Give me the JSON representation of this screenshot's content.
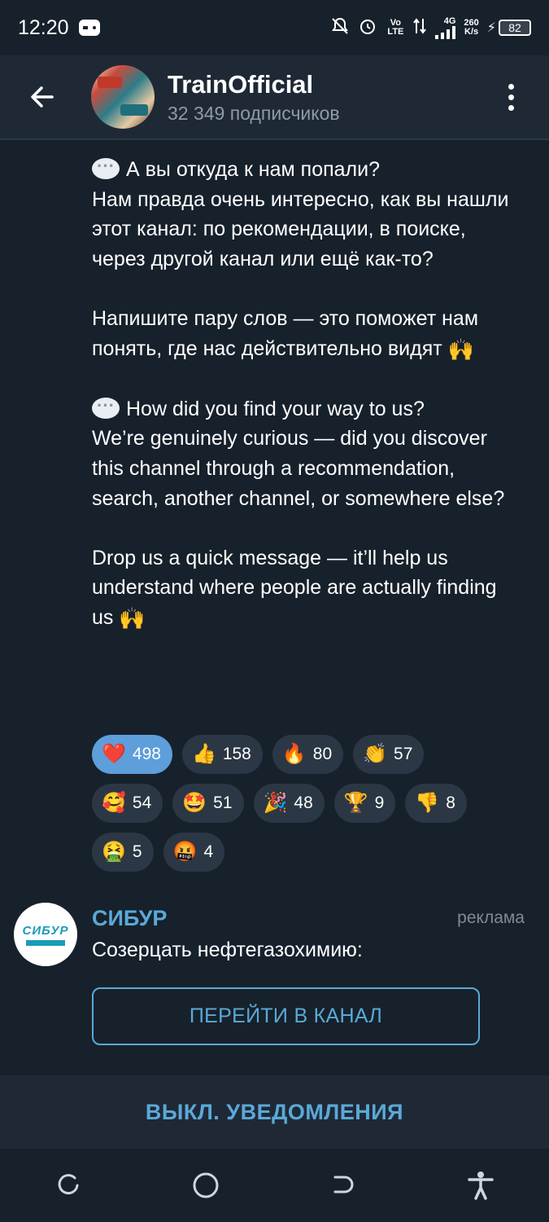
{
  "status": {
    "time": "12:20",
    "volte": "Vo LTE",
    "network": "4G",
    "speed_value": "260",
    "speed_unit": "K/s",
    "battery": "82"
  },
  "header": {
    "channel_name": "TrainOfficial",
    "subscribers": "32 349 подписчиков"
  },
  "message": {
    "ru_question": "А вы откуда к нам попали?",
    "ru_body": "Нам правда очень интересно, как вы нашли этот канал: по рекомендации, в поиске, через другой канал или ещё как-то?",
    "ru_call": "Напишите пару слов — это поможет нам понять, где нас действительно видят",
    "en_question": "How did you find your way to us?",
    "en_body": "We’re genuinely curious — did you discover this channel through a recommendation, search, another channel, or somewhere else?",
    "en_call": "Drop us a quick message — it’ll help us understand where people are actually finding us",
    "hands_emoji": "🙌",
    "speech_icon": "speech-bubble-icon"
  },
  "reactions": [
    {
      "emoji": "❤️",
      "count": "498",
      "active": true
    },
    {
      "emoji": "👍",
      "count": "158"
    },
    {
      "emoji": "🔥",
      "count": "80"
    },
    {
      "emoji": "👏",
      "count": "57"
    },
    {
      "emoji": "🥰",
      "count": "54"
    },
    {
      "emoji": "🤩",
      "count": "51"
    },
    {
      "emoji": "🎉",
      "count": "48"
    },
    {
      "emoji": "🏆",
      "count": "9"
    },
    {
      "emoji": "👎",
      "count": "8"
    },
    {
      "emoji": "🤮",
      "count": "5"
    },
    {
      "emoji": "🤬",
      "count": "4"
    }
  ],
  "ad": {
    "logo_text": "СИБУР",
    "title": "СИБУР",
    "label": "реклама",
    "text": "Созерцать нефтегазохимию:",
    "button": "ПЕРЕЙТИ В КАНАЛ"
  },
  "mute_bar": {
    "label": "ВЫКЛ. УВЕДОМЛЕНИЯ"
  },
  "colors": {
    "background": "#17212b",
    "header": "#1f2936",
    "accent": "#5aa9d8",
    "reaction_active": "#5d9edb",
    "reaction_bg": "#2b3744"
  }
}
